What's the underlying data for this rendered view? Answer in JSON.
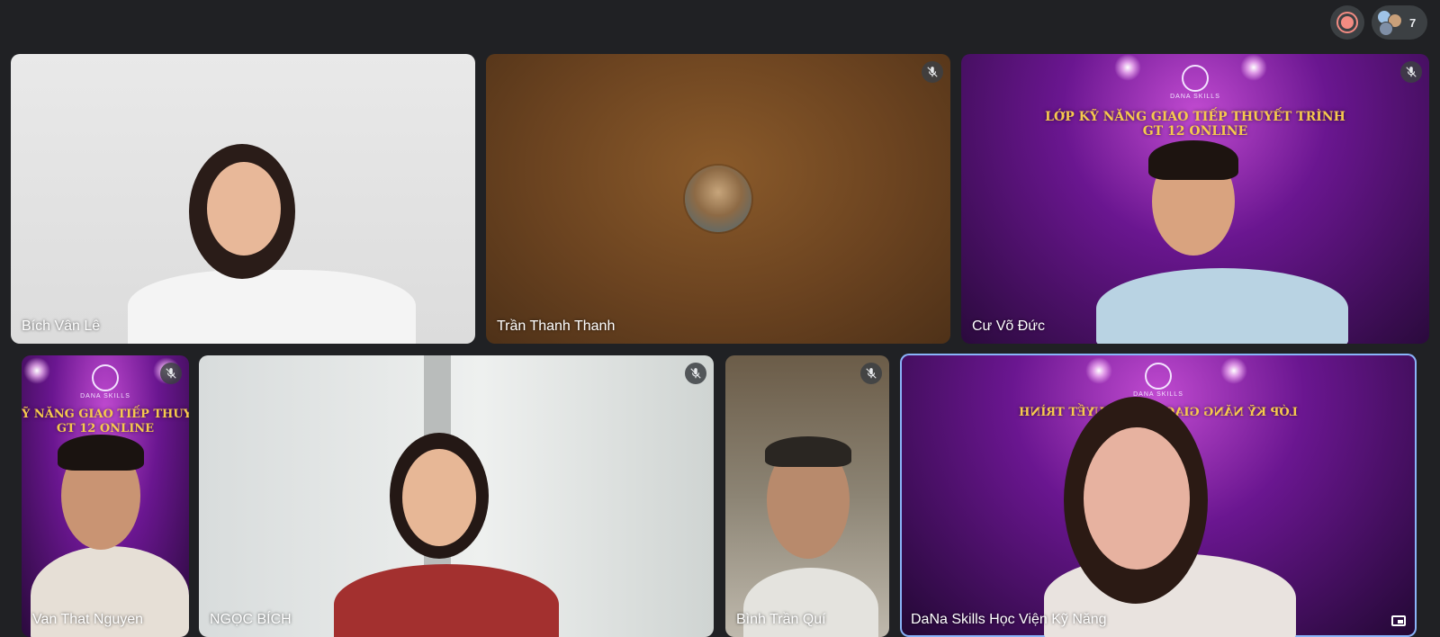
{
  "topbar": {
    "recording_icon": "record-icon",
    "participant_count": "7"
  },
  "tiles": [
    {
      "name": "Bích Vân Lê",
      "muted": false
    },
    {
      "name": "Trần Thanh Thanh",
      "muted": true
    },
    {
      "name": "Cư Võ Đức",
      "muted": true
    },
    {
      "name": "Van That Nguyen",
      "muted": true
    },
    {
      "name": "NGỌC BÍCH",
      "muted": true
    },
    {
      "name": "Bình Trần Quí",
      "muted": true
    },
    {
      "name": "DaNa Skills Học Viện Kỹ Năng",
      "muted": false,
      "active_speaker": true
    }
  ],
  "banner": {
    "brand": "DANA SKILLS",
    "line1": "LỚP KỸ NĂNG GIAO TIẾP THUYẾT TRÌNH",
    "line2": "GT 12 ONLINE",
    "line1_cropped": "Ỹ NĂNG GIAO TIẾP THUYẾ",
    "line1_mirrored": "LỚP KỸ NĂNG GIAO TIẾP THUYẾT TRÌNH"
  },
  "colors": {
    "background": "#202124",
    "banner_gold": "#f6c94d",
    "active_border": "#8ab4f8",
    "record_red": "#f28b82"
  }
}
